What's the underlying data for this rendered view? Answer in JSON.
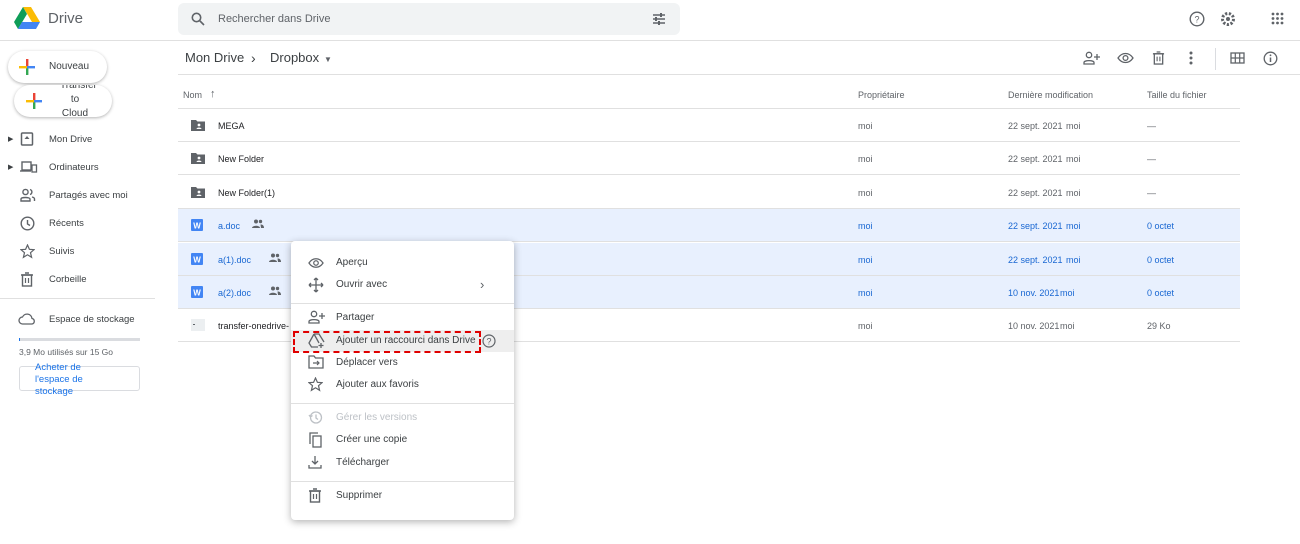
{
  "header": {
    "app_name": "Drive",
    "search_placeholder": "Rechercher dans Drive"
  },
  "sidebar": {
    "new_label": "Nouveau",
    "transfer_label": "Transfer to Cloud",
    "items": [
      {
        "label": "Mon Drive"
      },
      {
        "label": "Ordinateurs"
      },
      {
        "label": "Partagés avec moi"
      },
      {
        "label": "Récents"
      },
      {
        "label": "Suivis"
      },
      {
        "label": "Corbeille"
      }
    ],
    "storage_label": "Espace de stockage",
    "storage_usage": "3,9 Mo utilisés sur 15 Go",
    "storage_fraction": 0.0003,
    "buy_label": "Acheter de l'espace de stockage"
  },
  "breadcrumb": {
    "root": "Mon Drive",
    "current": "Dropbox"
  },
  "table": {
    "headers": {
      "name": "Nom",
      "owner": "Propriétaire",
      "modified": "Dernière modification",
      "size": "Taille du fichier"
    },
    "rows": [
      {
        "name": "MEGA",
        "type": "folder",
        "owner": "moi",
        "modified": "22 sept. 2021",
        "modified_by": "moi",
        "size": "—",
        "selected": false
      },
      {
        "name": "New Folder",
        "type": "folder",
        "owner": "moi",
        "modified": "22 sept. 2021",
        "modified_by": "moi",
        "size": "—",
        "selected": false
      },
      {
        "name": "New Folder(1)",
        "type": "folder",
        "owner": "moi",
        "modified": "22 sept. 2021",
        "modified_by": "moi",
        "size": "—",
        "selected": false
      },
      {
        "name": "a.doc",
        "type": "word",
        "owner": "moi",
        "modified": "22 sept. 2021",
        "modified_by": "moi",
        "size": "0 octet",
        "selected": true,
        "shared": true
      },
      {
        "name": "a(1).doc",
        "type": "word",
        "owner": "moi",
        "modified": "22 sept. 2021",
        "modified_by": "moi",
        "size": "0 octet",
        "selected": true,
        "shared": true
      },
      {
        "name": "a(2).doc",
        "type": "word",
        "owner": "moi",
        "modified": "10 nov. 2021",
        "modified_by": "moi",
        "size": "0 octet",
        "selected": true,
        "shared": true
      },
      {
        "name": "transfer-onedrive-",
        "type": "file",
        "owner": "moi",
        "modified": "10 nov. 2021",
        "modified_by": "moi",
        "size": "29 Ko",
        "selected": false
      }
    ]
  },
  "context_menu": {
    "items": [
      "Aperçu",
      "Ouvrir avec",
      "Partager",
      "Ajouter un raccourci dans Drive",
      "Déplacer vers",
      "Ajouter aux favoris",
      "Gérer les versions",
      "Créer une copie",
      "Télécharger",
      "Supprimer"
    ]
  }
}
